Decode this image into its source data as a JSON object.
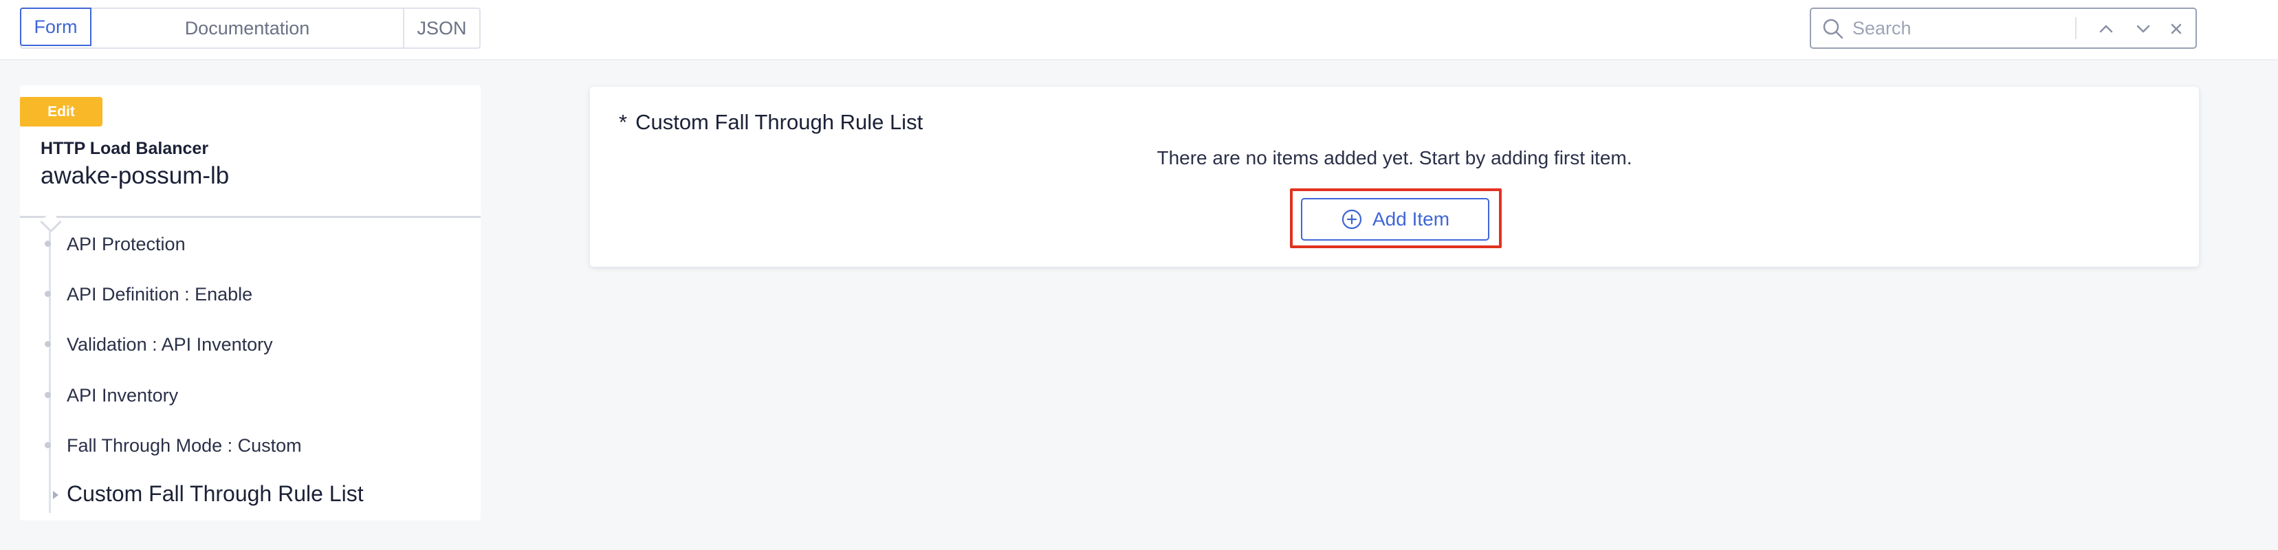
{
  "header": {
    "tabs": [
      {
        "label": "Form",
        "active": true
      },
      {
        "label": "Documentation",
        "active": false
      },
      {
        "label": "JSON",
        "active": false
      }
    ],
    "search": {
      "placeholder": "Search",
      "value": ""
    }
  },
  "sidebar": {
    "badge": "Edit",
    "object_type": "HTTP Load Balancer",
    "object_name": "awake-possum-lb",
    "items": [
      {
        "label": "API Protection"
      },
      {
        "label": "API Definition : Enable"
      },
      {
        "label": "Validation : API Inventory"
      },
      {
        "label": "API Inventory"
      },
      {
        "label": "Fall Through Mode : Custom"
      },
      {
        "label": "Custom Fall Through Rule List",
        "active": true
      }
    ]
  },
  "main": {
    "required_marker": "*",
    "section_title": "Custom Fall Through Rule List",
    "empty_message": "There are no items added yet. Start by adding first item.",
    "add_button_label": "Add Item"
  },
  "colors": {
    "accent": "#3f66d6",
    "badge": "#f9b827",
    "highlight": "#e0321f"
  },
  "icons": [
    "search-icon",
    "chevron-up-icon",
    "chevron-down-icon",
    "close-icon",
    "plus-circle-icon"
  ]
}
